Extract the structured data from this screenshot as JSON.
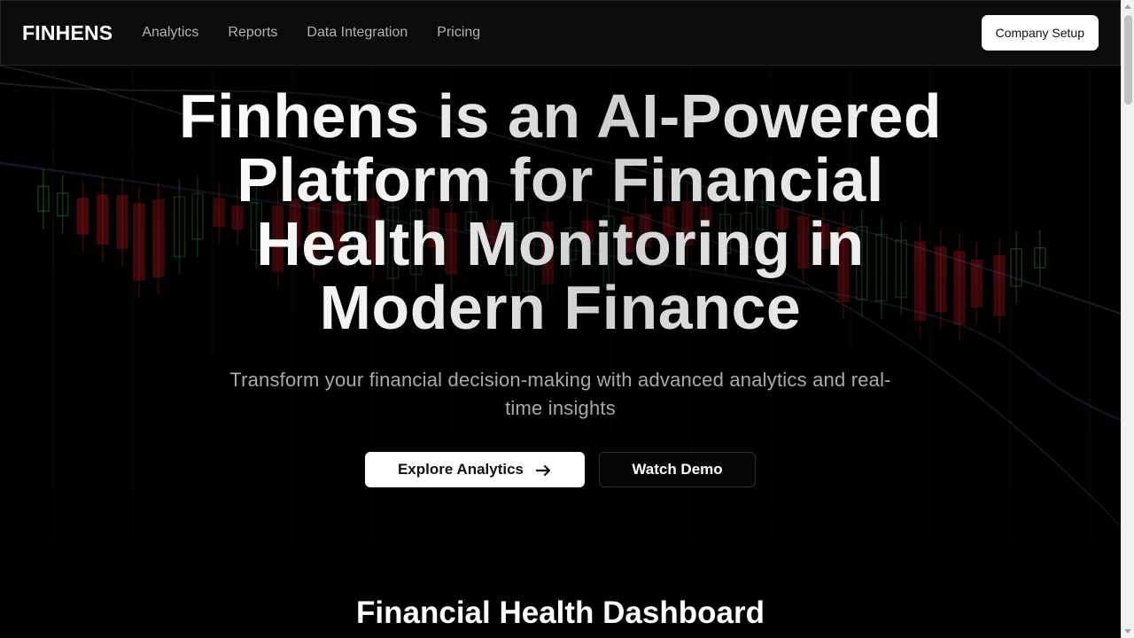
{
  "nav": {
    "logo": "FINHENS",
    "links": [
      "Analytics",
      "Reports",
      "Data Integration",
      "Pricing"
    ],
    "cta_label": "Company Setup"
  },
  "hero": {
    "title": "Finhens is an AI-Powered Platform for Financial Health Monitoring in Modern Finance",
    "subtitle": "Transform your financial decision-making with advanced analytics and real-time insights",
    "primary_button_label": "Explore Analytics",
    "primary_button_icon": "arrow-right-icon",
    "secondary_button_label": "Watch Demo"
  },
  "section": {
    "title": "Financial Health Dashboard"
  },
  "colors": {
    "background": "#000000",
    "navbar": "#0b0b0b",
    "button_primary_bg": "#ffffff",
    "candle_up": "#2e8b3f",
    "candle_down": "#b3161c"
  }
}
